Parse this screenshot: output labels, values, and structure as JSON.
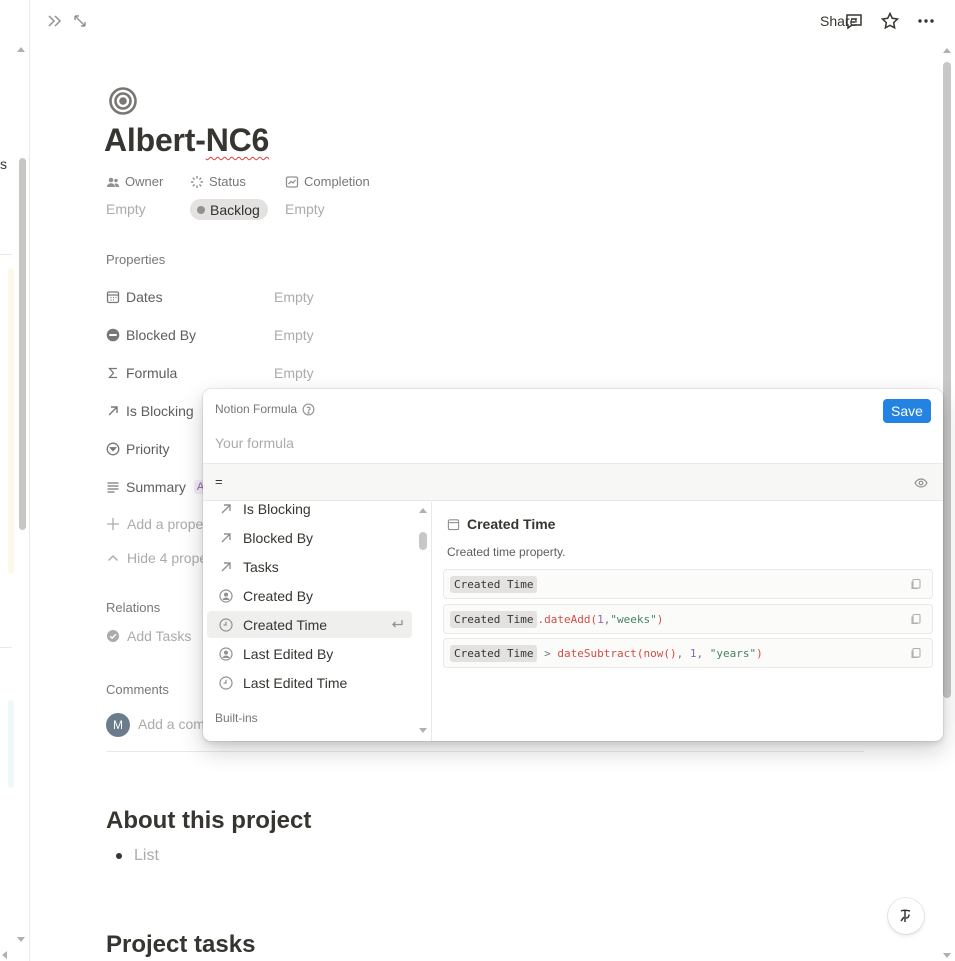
{
  "topbar": {
    "share_label": "Share",
    "icons": [
      "sidebar-expand-icon",
      "open-full-page-icon",
      "comment-icon",
      "star-icon",
      "more-icon"
    ]
  },
  "sidebar_fragment": {
    "text": "s"
  },
  "page": {
    "title_part1": "Albert-",
    "title_part2": "NC6",
    "icon": "target-icon"
  },
  "pinned_props": {
    "owner": {
      "label": "Owner",
      "value": "Empty"
    },
    "status": {
      "label": "Status",
      "value": "Backlog"
    },
    "completion": {
      "label": "Completion",
      "value": "Empty"
    }
  },
  "properties": {
    "header": "Properties",
    "rows": [
      {
        "name": "Dates",
        "value": "Empty"
      },
      {
        "name": "Blocked By",
        "value": "Empty"
      },
      {
        "name": "Formula",
        "value": "Empty"
      },
      {
        "name": "Is Blocking",
        "value": ""
      },
      {
        "name": "Priority",
        "value": ""
      },
      {
        "name": "Summary",
        "value": "A"
      }
    ],
    "add_property": "Add a prope",
    "hide_properties": "Hide 4 prope"
  },
  "relations": {
    "header": "Relations",
    "add_tasks": "Add Tasks"
  },
  "comments": {
    "header": "Comments",
    "avatar_initial": "M",
    "placeholder": "Add a com"
  },
  "sections": {
    "about": "About this project",
    "list_placeholder": "List",
    "tasks": "Project tasks"
  },
  "formula_popup": {
    "title": "Notion Formula",
    "save_label": "Save",
    "formula_placeholder": "Your formula",
    "result_prefix": "=",
    "list_items": [
      {
        "label": "Is Blocking",
        "icon": "relation-arrow-icon"
      },
      {
        "label": "Blocked By",
        "icon": "relation-arrow-icon"
      },
      {
        "label": "Tasks",
        "icon": "relation-arrow-icon"
      },
      {
        "label": "Created By",
        "icon": "person-icon"
      },
      {
        "label": "Created Time",
        "icon": "clock-icon",
        "selected": true
      },
      {
        "label": "Last Edited By",
        "icon": "person-icon"
      },
      {
        "label": "Last Edited Time",
        "icon": "clock-icon"
      }
    ],
    "group_label": "Built-ins",
    "detail": {
      "title": "Created Time",
      "description": "Created time property.",
      "ex1_chip": "Created Time",
      "ex2_chip": "Created Time",
      "ex2_fn": ".dateAdd(",
      "ex2_num": "1",
      "ex2_sep": ", ",
      "ex2_str": "\"weeks\"",
      "ex2_close": ")",
      "ex3_chip": "Created Time",
      "ex3_op": " > ",
      "ex3_fn": "dateSubtract(",
      "ex3_fn2": "now()",
      "ex3_sep1": ", ",
      "ex3_num": "1",
      "ex3_sep2": ", ",
      "ex3_str": "\"years\"",
      "ex3_close": ")"
    }
  },
  "colors": {
    "accent": "#2383e2",
    "status_pill": "#e3e2e0",
    "text": "#37352f",
    "muted": "#acaba9"
  }
}
